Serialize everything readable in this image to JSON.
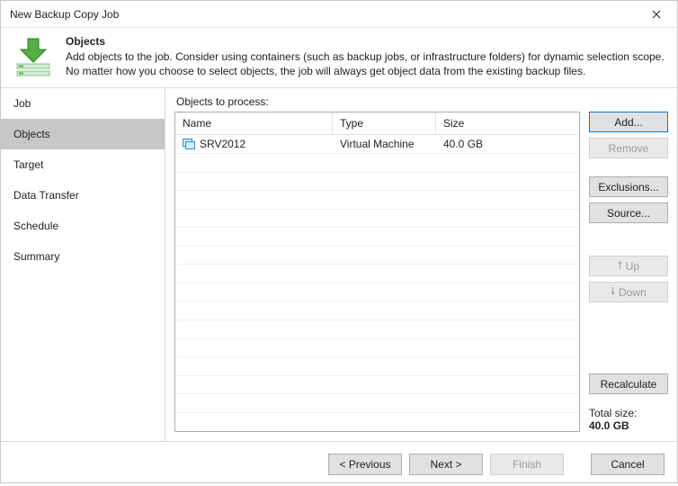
{
  "window": {
    "title": "New Backup Copy Job"
  },
  "header": {
    "heading": "Objects",
    "description": "Add objects to the job. Consider using containers (such as backup jobs, or infrastructure folders) for dynamic selection scope. No matter how you choose to select objects, the job will always get object data from the existing backup files."
  },
  "sidebar": {
    "items": [
      {
        "label": "Job"
      },
      {
        "label": "Objects"
      },
      {
        "label": "Target"
      },
      {
        "label": "Data Transfer"
      },
      {
        "label": "Schedule"
      },
      {
        "label": "Summary"
      }
    ],
    "selected_index": 1
  },
  "main": {
    "section_label": "Objects to process:",
    "columns": {
      "name": "Name",
      "type": "Type",
      "size": "Size"
    },
    "rows": [
      {
        "name": "SRV2012",
        "type": "Virtual Machine",
        "size": "40.0 GB"
      }
    ],
    "actions": {
      "add": "Add...",
      "remove": "Remove",
      "exclusions": "Exclusions...",
      "source": "Source...",
      "up": "Up",
      "down": "Down",
      "recalculate": "Recalculate"
    },
    "totals": {
      "label": "Total size:",
      "value": "40.0 GB"
    }
  },
  "footer": {
    "previous": "< Previous",
    "next": "Next >",
    "finish": "Finish",
    "cancel": "Cancel"
  }
}
